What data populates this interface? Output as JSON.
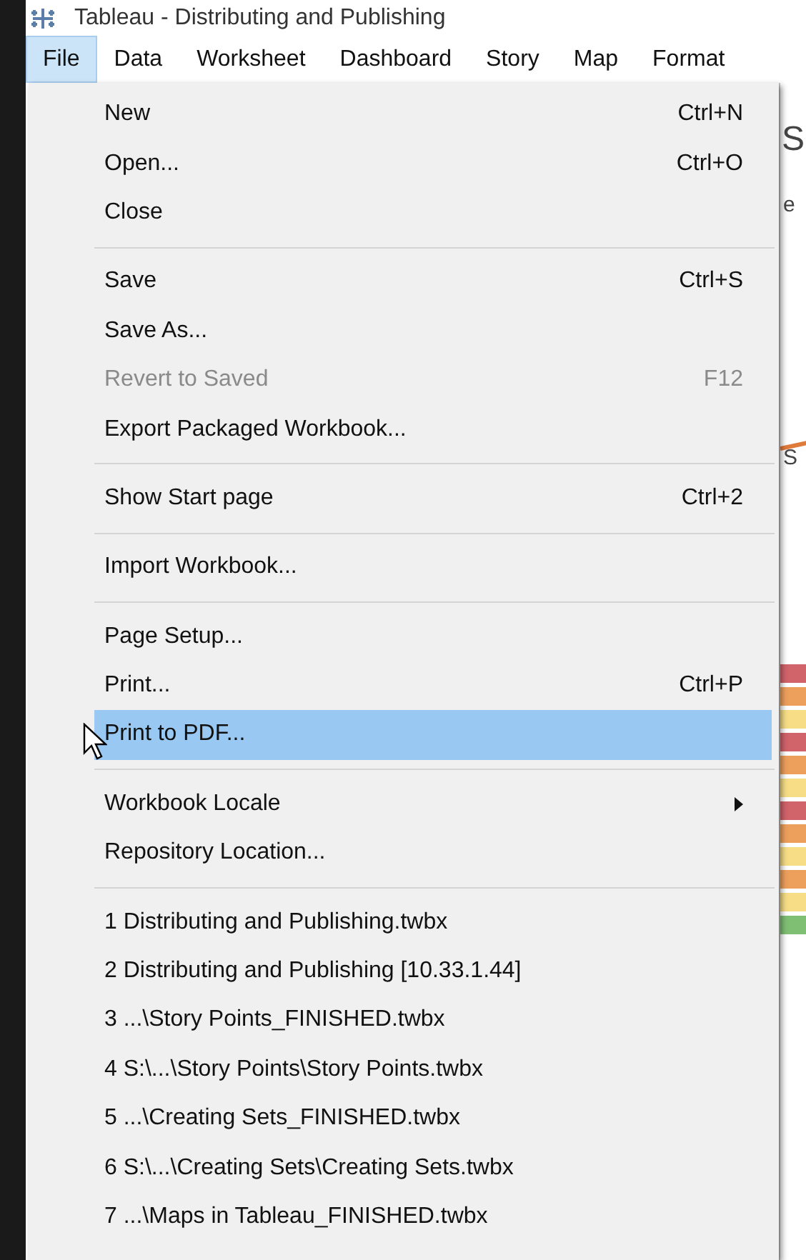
{
  "window": {
    "title": "Tableau - Distributing and Publishing"
  },
  "menu_bar": [
    {
      "label": "File",
      "selected": true
    },
    {
      "label": "Data",
      "selected": false
    },
    {
      "label": "Worksheet",
      "selected": false
    },
    {
      "label": "Dashboard",
      "selected": false
    },
    {
      "label": "Story",
      "selected": false
    },
    {
      "label": "Map",
      "selected": false
    },
    {
      "label": "Format",
      "selected": false
    }
  ],
  "file_menu": [
    {
      "kind": "item",
      "label": "New",
      "shortcut": "Ctrl+N",
      "disabled": false,
      "selected": false
    },
    {
      "kind": "item",
      "label": "Open...",
      "shortcut": "Ctrl+O",
      "disabled": false,
      "selected": false
    },
    {
      "kind": "item",
      "label": "Close",
      "disabled": false,
      "selected": false
    },
    {
      "kind": "separator"
    },
    {
      "kind": "item",
      "label": "Save",
      "shortcut": "Ctrl+S",
      "disabled": false,
      "selected": false
    },
    {
      "kind": "item",
      "label": "Save As...",
      "disabled": false,
      "selected": false
    },
    {
      "kind": "item",
      "label": "Revert to Saved",
      "shortcut": "F12",
      "disabled": true,
      "selected": false
    },
    {
      "kind": "item",
      "label": "Export Packaged Workbook...",
      "disabled": false,
      "selected": false
    },
    {
      "kind": "separator"
    },
    {
      "kind": "item",
      "label": "Show Start page",
      "shortcut": "Ctrl+2",
      "disabled": false,
      "selected": false
    },
    {
      "kind": "separator"
    },
    {
      "kind": "item",
      "label": "Import Workbook...",
      "disabled": false,
      "selected": false
    },
    {
      "kind": "separator"
    },
    {
      "kind": "item",
      "label": "Page Setup...",
      "disabled": false,
      "selected": false
    },
    {
      "kind": "item",
      "label": "Print...",
      "shortcut": "Ctrl+P",
      "disabled": false,
      "selected": false
    },
    {
      "kind": "item",
      "label": "Print to PDF...",
      "disabled": false,
      "selected": true
    },
    {
      "kind": "separator"
    },
    {
      "kind": "submenu",
      "label": "Workbook Locale",
      "disabled": false,
      "selected": false
    },
    {
      "kind": "item",
      "label": "Repository Location...",
      "disabled": false,
      "selected": false
    },
    {
      "kind": "separator"
    },
    {
      "kind": "item",
      "label": "1 Distributing and Publishing.twbx",
      "disabled": false,
      "selected": false
    },
    {
      "kind": "item",
      "label": "2 Distributing and Publishing [10.33.1.44]",
      "disabled": false,
      "selected": false
    },
    {
      "kind": "item",
      "label": "3 ...\\Story Points_FINISHED.twbx",
      "disabled": false,
      "selected": false
    },
    {
      "kind": "item",
      "label": "4 S:\\...\\Story Points\\Story Points.twbx",
      "disabled": false,
      "selected": false
    },
    {
      "kind": "item",
      "label": "5 ...\\Creating Sets_FINISHED.twbx",
      "disabled": false,
      "selected": false
    },
    {
      "kind": "item",
      "label": "6 S:\\...\\Creating Sets\\Creating Sets.twbx",
      "disabled": false,
      "selected": false
    },
    {
      "kind": "item",
      "label": "7 ...\\Maps in Tableau_FINISHED.twbx",
      "disabled": false,
      "selected": false
    }
  ],
  "background": {
    "texts": [
      "S",
      "e",
      "S"
    ]
  }
}
